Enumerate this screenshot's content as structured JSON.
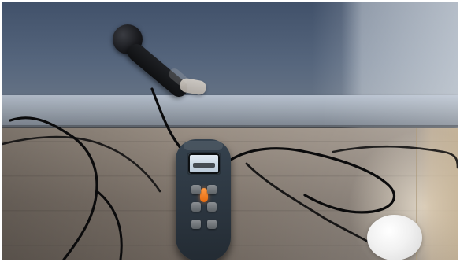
{
  "image": {
    "width": 584,
    "height": 333,
    "style": "photo",
    "scene": {
      "objects": [
        "wall",
        "baseboard",
        "floor",
        "sensor-probe",
        "handheld-meter",
        "cables",
        "white-disc"
      ]
    },
    "palette": {
      "wall": "#4f5f76",
      "baseboard": "#aab4c1",
      "floor": "#8b8178",
      "cables": "#0b0b0c",
      "meter_body": "#2c3640",
      "meter_screen": "#d3dfea",
      "meter_accent": "#ff8a2a",
      "highlight": "#f3efe6"
    }
  }
}
